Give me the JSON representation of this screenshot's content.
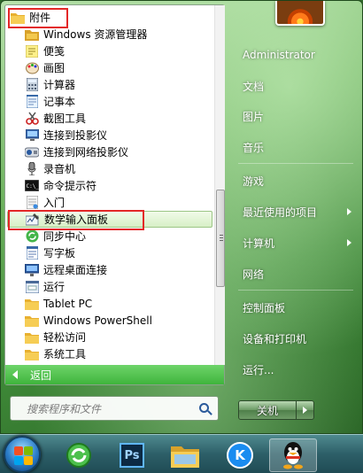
{
  "programs": {
    "folder_label": "附件",
    "items": [
      {
        "label": "Windows 资源管理器",
        "icon": "folder-explorer-icon"
      },
      {
        "label": "便笺",
        "icon": "sticky-notes-icon"
      },
      {
        "label": "画图",
        "icon": "paint-icon"
      },
      {
        "label": "计算器",
        "icon": "calculator-icon"
      },
      {
        "label": "记事本",
        "icon": "notepad-icon"
      },
      {
        "label": "截图工具",
        "icon": "snipping-tool-icon"
      },
      {
        "label": "连接到投影仪",
        "icon": "projector-icon"
      },
      {
        "label": "连接到网络投影仪",
        "icon": "network-projector-icon"
      },
      {
        "label": "录音机",
        "icon": "microphone-icon"
      },
      {
        "label": "命令提示符",
        "icon": "command-prompt-icon"
      },
      {
        "label": "入门",
        "icon": "getting-started-icon"
      },
      {
        "label": "数学输入面板",
        "icon": "math-input-icon"
      },
      {
        "label": "同步中心",
        "icon": "sync-center-icon"
      },
      {
        "label": "写字板",
        "icon": "wordpad-icon"
      },
      {
        "label": "远程桌面连接",
        "icon": "remote-desktop-icon"
      },
      {
        "label": "运行",
        "icon": "run-icon"
      }
    ],
    "subfolders": [
      {
        "label": "Tablet PC",
        "icon": "folder-icon"
      },
      {
        "label": "Windows PowerShell",
        "icon": "folder-icon"
      },
      {
        "label": "轻松访问",
        "icon": "folder-icon"
      },
      {
        "label": "系统工具",
        "icon": "folder-icon"
      }
    ],
    "back_label": "返回"
  },
  "search": {
    "placeholder": "搜索程序和文件"
  },
  "right_pane": {
    "items": [
      {
        "label": "Administrator"
      },
      {
        "label": "文档"
      },
      {
        "label": "图片"
      },
      {
        "label": "音乐"
      },
      {
        "label": "游戏"
      },
      {
        "label": "最近使用的项目"
      },
      {
        "label": "计算机"
      },
      {
        "label": "网络"
      },
      {
        "label": "控制面板"
      },
      {
        "label": "设备和打印机"
      },
      {
        "label": "运行..."
      }
    ],
    "shutdown_label": "关机"
  },
  "taskbar": {
    "items": [
      {
        "icon": "start-orb-icon"
      },
      {
        "icon": "browser-icon"
      },
      {
        "icon": "photoshop-icon",
        "text": "Ps"
      },
      {
        "icon": "file-explorer-icon"
      },
      {
        "icon": "kugou-icon",
        "text": "K"
      },
      {
        "icon": "qq-penguin-icon"
      }
    ]
  },
  "colors": {
    "highlight_box": "#e32727",
    "back_bar": "#3fb43c",
    "accent": "#2a7cc7"
  }
}
